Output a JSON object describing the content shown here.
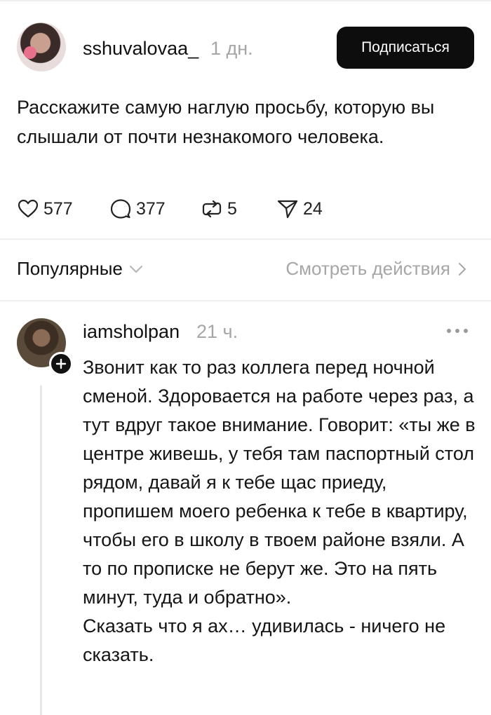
{
  "post": {
    "username": "sshuvalovaa_",
    "time": "1 дн.",
    "subscribe_label": "Подписаться",
    "text": "Расскажите самую наглую просьбу, которую вы слышали от почти незнакомого человека.",
    "stats": {
      "likes": "577",
      "comments": "377",
      "reposts": "5",
      "shares": "24"
    }
  },
  "sort": {
    "selected": "Популярные",
    "view_activity": "Смотреть действия"
  },
  "comment": {
    "username": "iamsholpan",
    "time": "21 ч.",
    "text": "Звонит как то раз коллега перед ночной сменой. Здоровается на работе через раз, а тут вдруг такое внимание. Говорит: «ты же в центре живешь, у тебя там паспортный стол рядом, давай я к тебе щас приеду, пропишем моего ребенка к тебе в квартиру, чтобы его в школу в твоем районе взяли. А то по прописке не берут же. Это на пять минут, туда и обратно».\nСказать что я ах… удивилась - ничего не сказать."
  },
  "icons": {
    "like": "heart-icon",
    "comment": "comment-bubble-icon",
    "repost": "repost-icon",
    "share": "send-icon",
    "sort": "chevron-down-icon",
    "activity": "chevron-right-icon",
    "more": "more-dots-icon",
    "follow": "plus-icon"
  }
}
